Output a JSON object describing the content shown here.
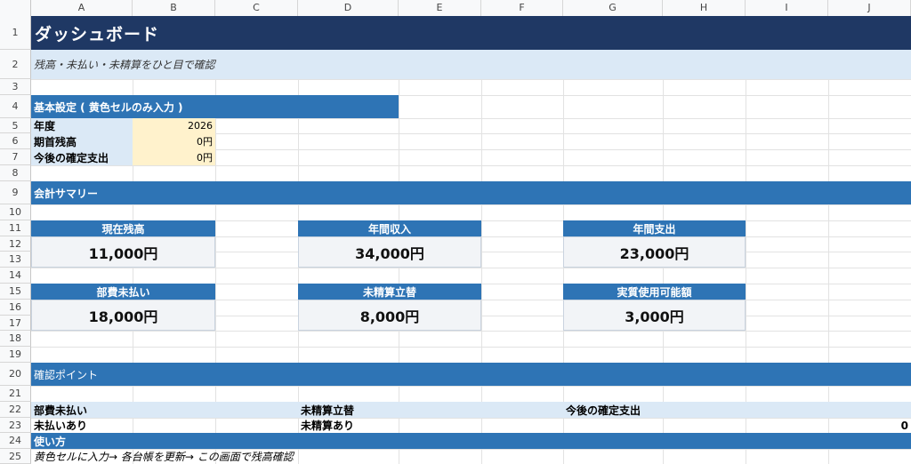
{
  "columns": [
    "A",
    "B",
    "C",
    "D",
    "E",
    "F",
    "G",
    "H",
    "I",
    "J"
  ],
  "rows": [
    "1",
    "2",
    "3",
    "4",
    "5",
    "6",
    "7",
    "8",
    "9",
    "10",
    "11",
    "12",
    "13",
    "14",
    "15",
    "16",
    "17",
    "18",
    "19",
    "20",
    "21",
    "22",
    "23",
    "24",
    "25"
  ],
  "header": {
    "title": "ダッシュボード",
    "subtitle": "残高・未払い・未精算をひと目で確認"
  },
  "settings": {
    "section": "基本設定 ( 黄色セルのみ入力 )",
    "rows": [
      {
        "label": "年度",
        "value": "2026"
      },
      {
        "label": "期首残高",
        "value": "0円"
      },
      {
        "label": "今後の確定支出",
        "value": "0円"
      }
    ]
  },
  "summary": {
    "section": "会計サマリー",
    "cards": [
      {
        "label": "現在残高",
        "value": "11,000円"
      },
      {
        "label": "年間収入",
        "value": "34,000円"
      },
      {
        "label": "年間支出",
        "value": "23,000円"
      },
      {
        "label": "部費未払い",
        "value": "18,000円"
      },
      {
        "label": "未精算立替",
        "value": "8,000円"
      },
      {
        "label": "実質使用可能額",
        "value": "3,000円"
      }
    ]
  },
  "points": {
    "section": "確認ポイント",
    "headers": [
      "部費未払い",
      "未精算立替",
      "今後の確定支出"
    ],
    "values": [
      "未払いあり",
      "未精算あり",
      "0"
    ]
  },
  "usage": {
    "section": "使い方",
    "text": "黄色セルに入力→ 各台帳を更新→ この画面で残高確認"
  },
  "colors": {
    "title_bg": "#1f3864",
    "section_bg": "#2e74b5",
    "light_blue": "#dbe9f6",
    "input_yellow": "#fff2cc"
  }
}
